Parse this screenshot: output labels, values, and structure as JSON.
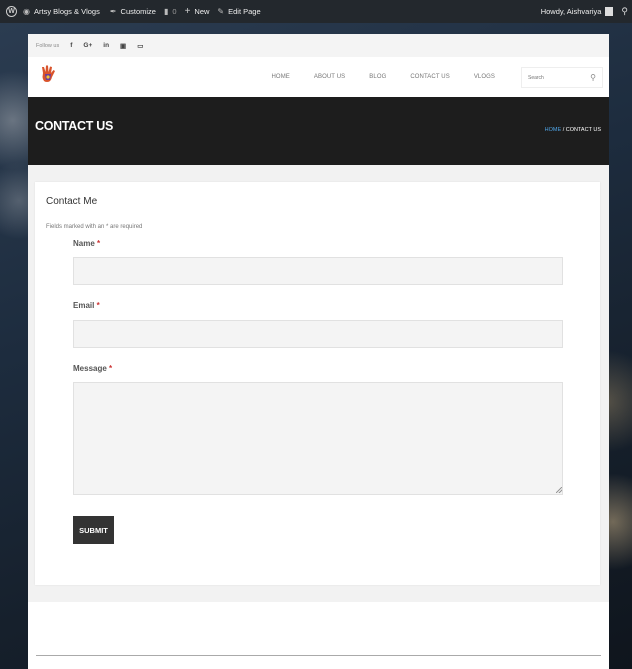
{
  "adminbar": {
    "site_name": "Artsy Blogs & Vlogs",
    "customize": "Customize",
    "comments_count": "0",
    "new_label": "New",
    "edit_page": "Edit Page",
    "howdy": "Howdy, Aishvariya"
  },
  "follow": {
    "label": "Follow us",
    "icons": [
      "facebook-icon",
      "google-plus-icon",
      "linkedin-icon",
      "instagram-icon",
      "youtube-icon"
    ]
  },
  "nav": {
    "items": [
      "HOME",
      "ABOUT US",
      "BLOG",
      "CONTACT US",
      "VLOGS"
    ],
    "search_placeholder": "Search"
  },
  "hero": {
    "title": "CONTACT US",
    "breadcrumb_home": "HOME",
    "breadcrumb_sep": "/",
    "breadcrumb_current": "CONTACT US"
  },
  "form": {
    "title": "Contact Me",
    "required_note": "Fields marked with an * are required",
    "name_label": "Name",
    "email_label": "Email",
    "message_label": "Message",
    "required_mark": "*",
    "submit_label": "SUBMIT"
  },
  "colors": {
    "admin_bar": "#23282d",
    "hero_bg": "#1d1d1d",
    "breadcrumb_link": "#4ea4e6",
    "submit_bg": "#333333",
    "required_mark": "#cc3333"
  }
}
